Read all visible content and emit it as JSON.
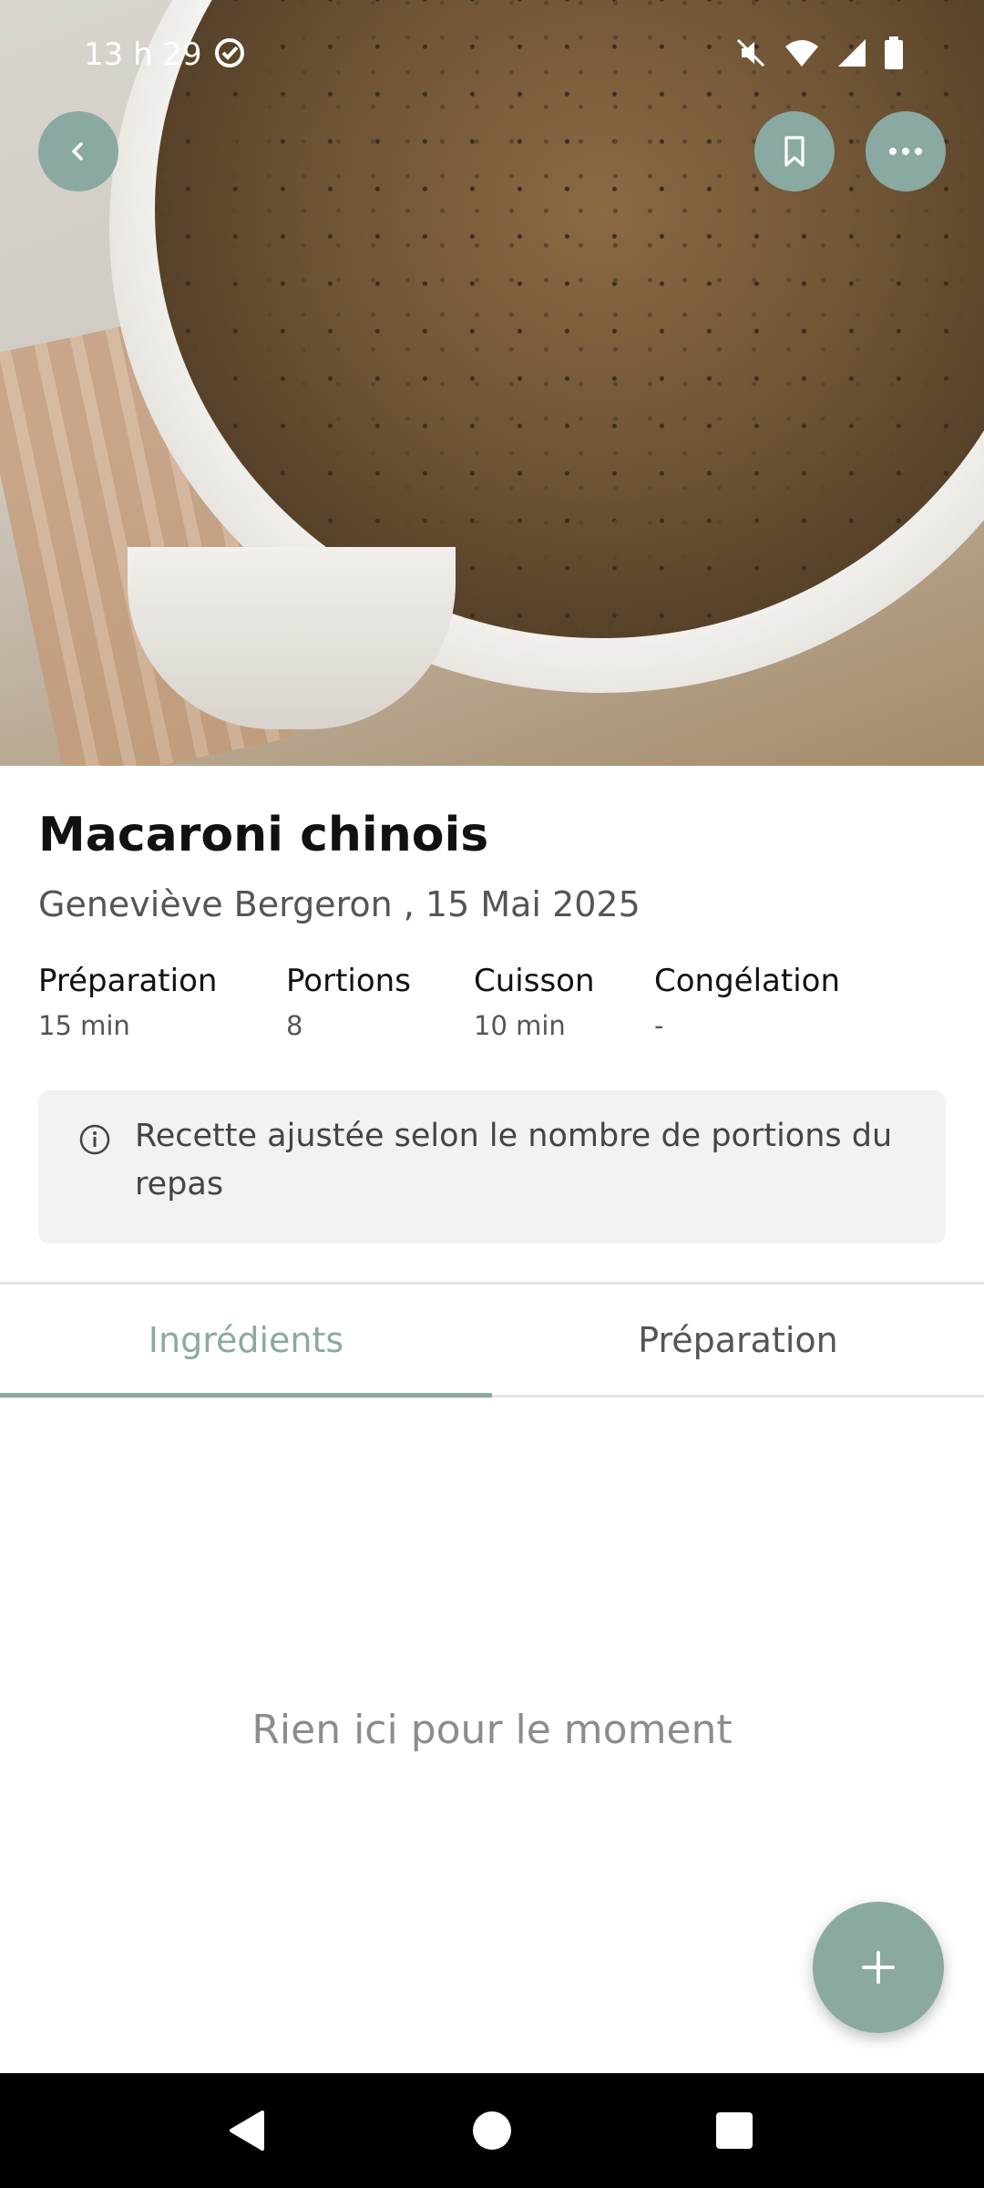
{
  "status_bar": {
    "time": "13 h 29"
  },
  "hero": {
    "image_alt": "Macaroni chinois"
  },
  "recipe": {
    "title": "Macaroni chinois",
    "byline": "Geneviève Bergeron , 15 Mai 2025",
    "meta": [
      {
        "label": "Préparation",
        "value": "15 min"
      },
      {
        "label": "Portions",
        "value": "8"
      },
      {
        "label": "Cuisson",
        "value": "10 min"
      },
      {
        "label": "Congélation",
        "value": "-"
      }
    ]
  },
  "notice": {
    "text": "Recette ajustée selon le nombre de portions du repas"
  },
  "tabs": [
    {
      "label": "Ingrédients",
      "active": true
    },
    {
      "label": "Préparation",
      "active": false
    }
  ],
  "empty_state": {
    "text": "Rien ici pour le moment"
  },
  "colors": {
    "accent": "#8aa9a2",
    "notice_bg": "#f3f2f0",
    "nav_bar": "#000000"
  },
  "icons": {
    "back": "chevron-left-icon",
    "bookmark": "bookmark-icon",
    "more": "more-horizontal-icon",
    "info": "info-icon",
    "add": "plus-icon"
  }
}
